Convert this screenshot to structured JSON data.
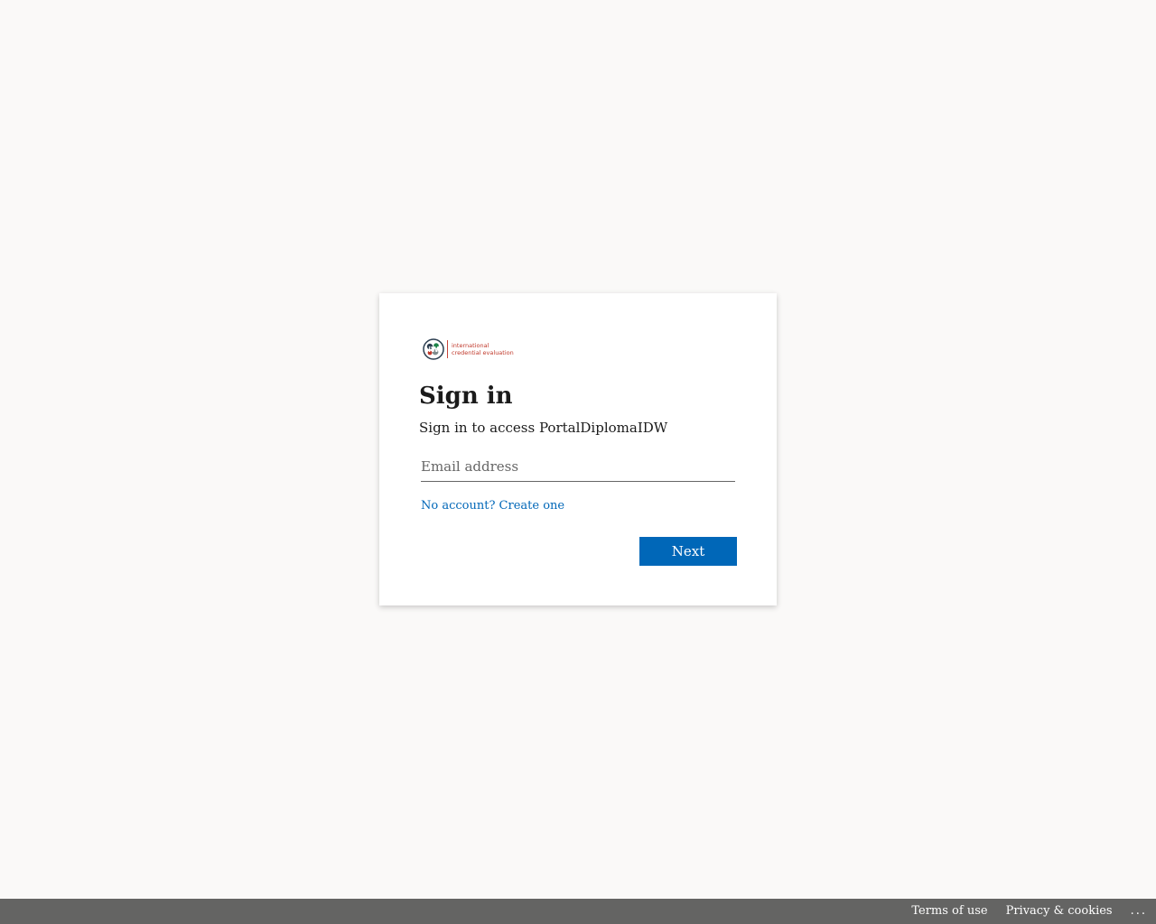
{
  "logo": {
    "line1": "international",
    "line2": "credential evaluation",
    "colors": {
      "text": "#c0392b",
      "mark_dark": "#2c3e50",
      "mark_green": "#1e8449"
    }
  },
  "signin": {
    "title": "Sign in",
    "subtitle": "Sign in to access PortalDiplomaIDW",
    "email_placeholder": "Email address",
    "email_value": "",
    "create_account_link": "No account? Create one",
    "next_label": "Next"
  },
  "footer": {
    "terms_label": "Terms of use",
    "privacy_label": "Privacy & cookies",
    "more_label": "..."
  },
  "colors": {
    "accent": "#0067b8",
    "page_background": "#faf9f8",
    "footer_background": "#666666"
  }
}
